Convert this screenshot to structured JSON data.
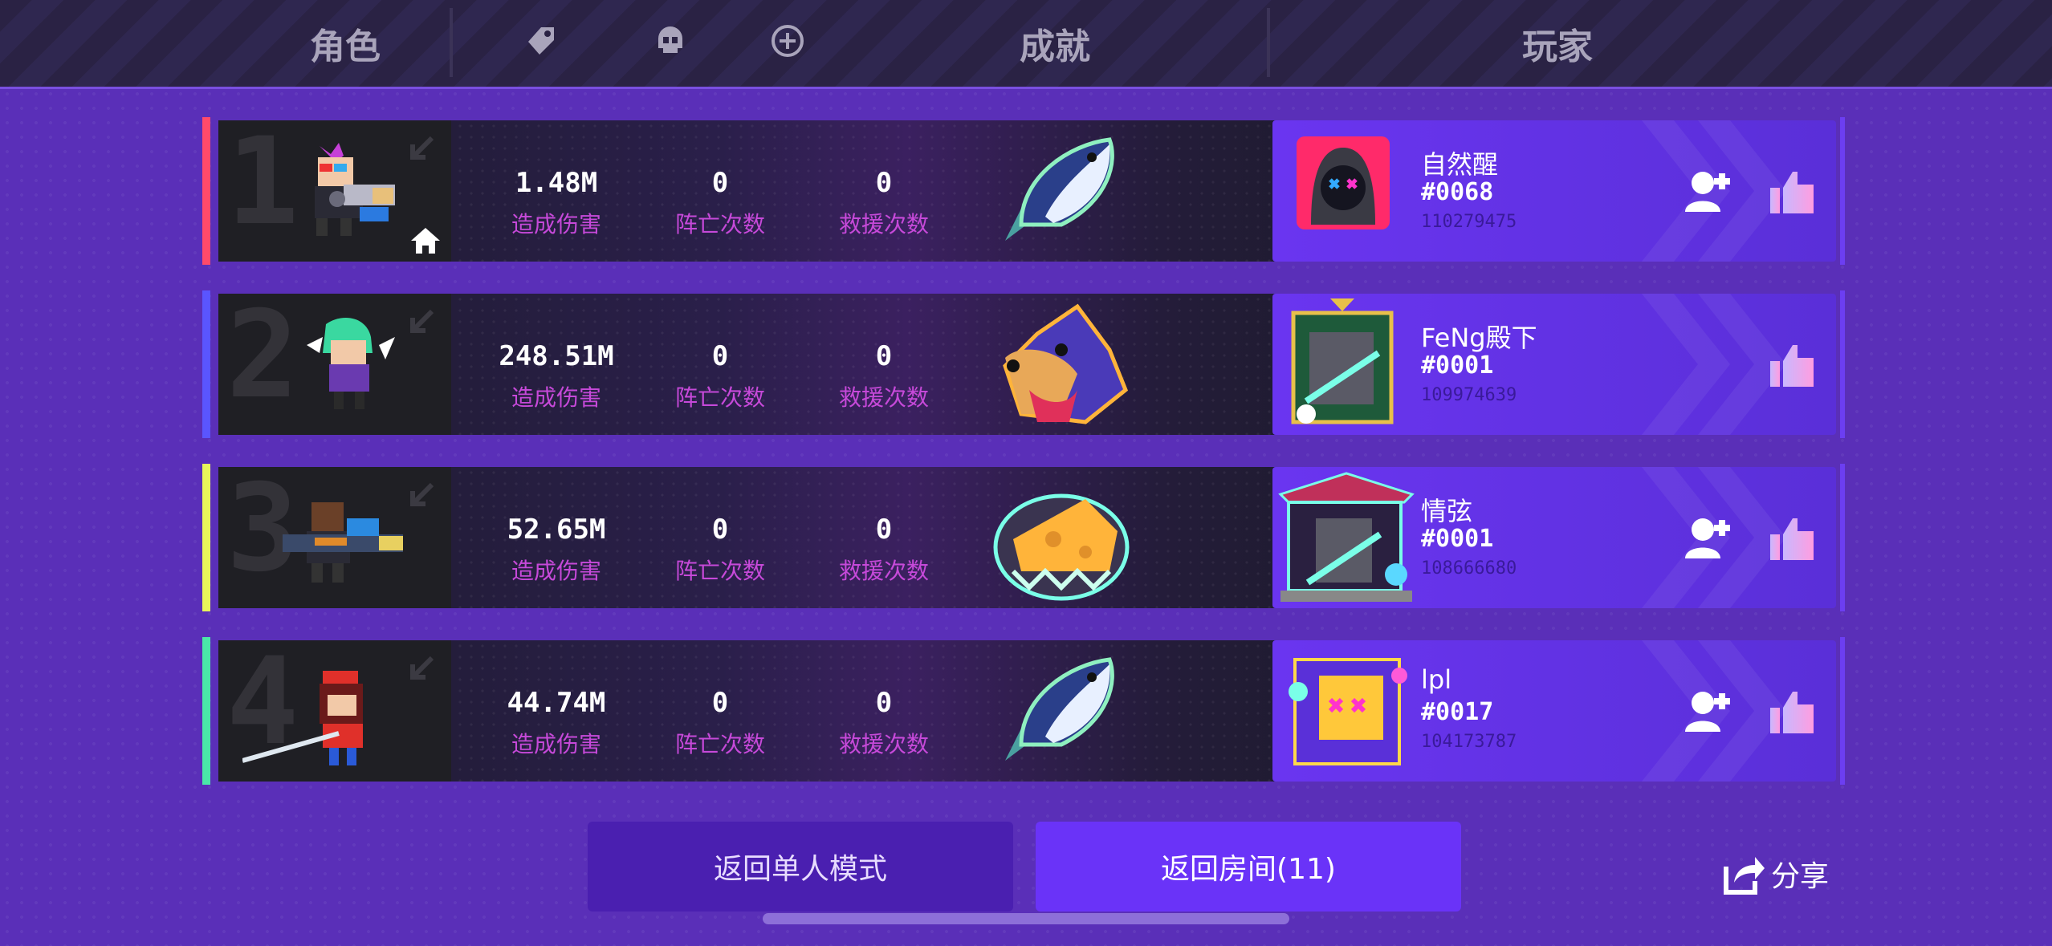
{
  "header": {
    "tab_role": "角色",
    "tab_achievement": "成就",
    "tab_player": "玩家",
    "icons": [
      "tag-icon",
      "skull-icon",
      "plus-circle-icon"
    ]
  },
  "stat_labels": {
    "damage": "造成伤害",
    "deaths": "阵亡次数",
    "rescues": "救援次数"
  },
  "colors": {
    "rank1": "#ff4a6a",
    "rank2": "#5a55ff",
    "rank3": "#e8f55a",
    "rank4": "#4ae8a8",
    "accent": "#6a33f8",
    "label": "#c649d9"
  },
  "rows": [
    {
      "rank": "1",
      "damage": "1.48M",
      "deaths": "0",
      "rescues": "0",
      "achievement": "fish-icon",
      "player": {
        "name": "自然醒",
        "tag": "#0068",
        "id": "110279475",
        "can_add": true
      }
    },
    {
      "rank": "2",
      "damage": "248.51M",
      "deaths": "0",
      "rescues": "0",
      "achievement": "wolf-icon",
      "player": {
        "name": "FeNg殿下",
        "tag": "#0001",
        "id": "109974639",
        "can_add": false
      }
    },
    {
      "rank": "3",
      "damage": "52.65M",
      "deaths": "0",
      "rescues": "0",
      "achievement": "cheese-icon",
      "player": {
        "name": "情弦",
        "tag": "#0001",
        "id": "108666680",
        "can_add": true
      }
    },
    {
      "rank": "4",
      "damage": "44.74M",
      "deaths": "0",
      "rescues": "0",
      "achievement": "fish-icon",
      "player": {
        "name": "lpl",
        "tag": "#0017",
        "id": "104173787",
        "can_add": true
      }
    }
  ],
  "buttons": {
    "back_single": "返回单人模式",
    "back_room": "返回房间(11)",
    "share": "分享"
  }
}
